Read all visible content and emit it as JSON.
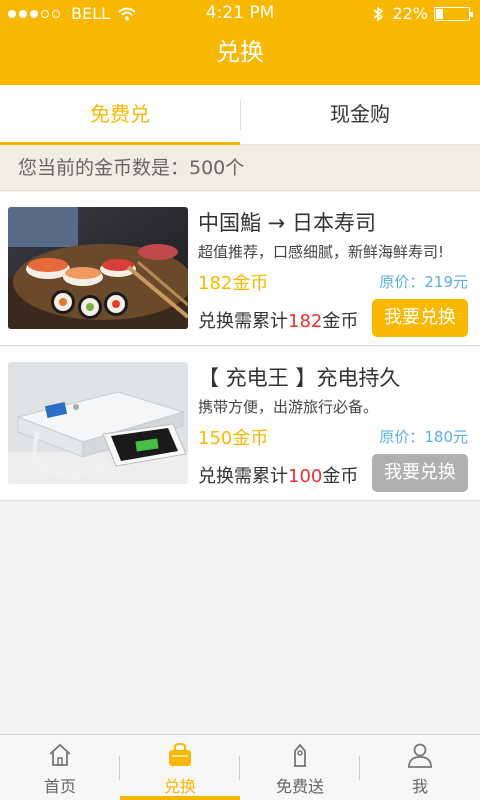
{
  "status": {
    "carrier": "BELL",
    "time": "4:21 PM",
    "battery": "22%"
  },
  "header": {
    "title": "兑换"
  },
  "tabs": [
    {
      "label": "免费兑"
    },
    {
      "label": "现金购"
    }
  ],
  "coins": {
    "text": "您当前的金币数是：500个"
  },
  "products": [
    {
      "title": "中国鮨 → 日本寿司",
      "desc": "超值推荐，口感细腻，新鲜海鲜寿司!",
      "coin_price": "182金币",
      "orig_price": "原价：219元",
      "need_prefix": "兑换需累计",
      "need_num": "182",
      "need_suffix": "金币",
      "button": "我要兑换",
      "button_state": "enabled"
    },
    {
      "title": "【 充电王 】充电持久",
      "desc": "携带方便，出游旅行必备。",
      "coin_price": "150金币",
      "orig_price": "原价：180元",
      "need_prefix": "兑换需累计",
      "need_num": "100",
      "need_suffix": "金币",
      "button": "我要兑换",
      "button_state": "disabled"
    }
  ],
  "tabbar": [
    {
      "label": "首页",
      "icon": "home-icon"
    },
    {
      "label": "兑换",
      "icon": "bag-icon",
      "active": true
    },
    {
      "label": "免费送",
      "icon": "tag-icon"
    },
    {
      "label": "我",
      "icon": "person-icon"
    }
  ],
  "colors": {
    "accent": "#f8b800",
    "price_blue": "#5aaee8",
    "highlight_red": "#e8312e",
    "disabled_gray": "#b0b0b0"
  }
}
